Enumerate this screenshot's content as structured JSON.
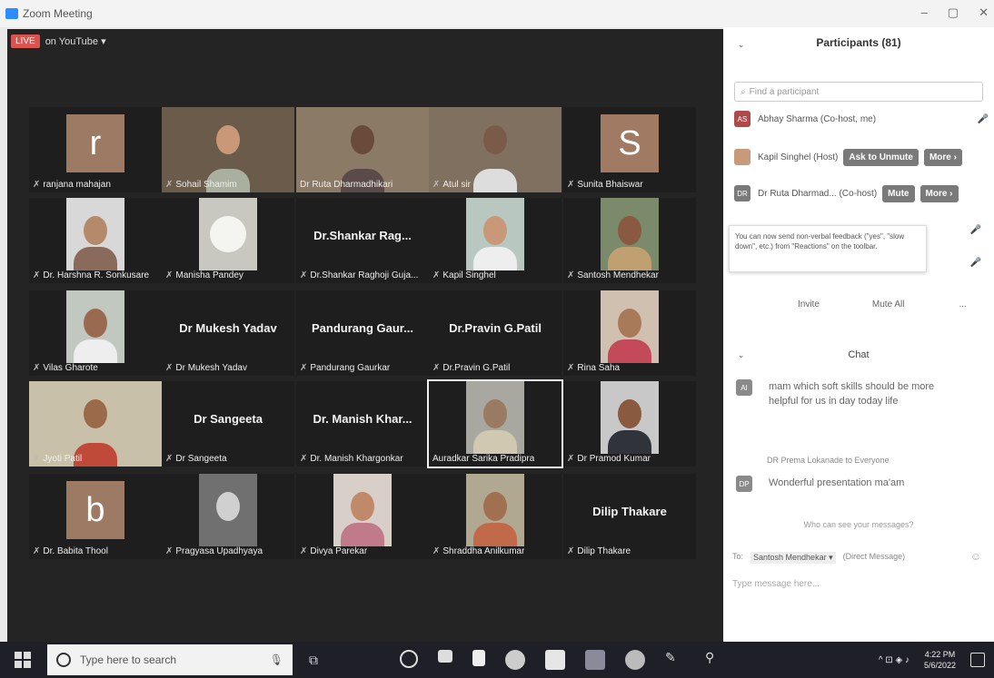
{
  "window": {
    "title": "Zoom Meeting"
  },
  "live": {
    "badge": "LIVE",
    "text": "on YouTube ▾"
  },
  "tiles": [
    {
      "name": "ranjana mahajan",
      "avatar_letter": "r"
    },
    {
      "name": "Sohail Shamim"
    },
    {
      "name": "Dr Ruta Dharmadhikari"
    },
    {
      "name": "Atul sir"
    },
    {
      "name": "Sunita Bhaiswar",
      "avatar_letter": "S"
    },
    {
      "name": "Dr. Harshna R. Sonkusare"
    },
    {
      "name": "Manisha Pandey"
    },
    {
      "name": "Dr.Shankar Raghoji Guja...",
      "display_name": "Dr.Shankar  Rag..."
    },
    {
      "name": "Kapil Singhel"
    },
    {
      "name": "Santosh Mendhekar"
    },
    {
      "name": "Vilas Gharote"
    },
    {
      "name": "Dr Mukesh Yadav",
      "display_name": "Dr Mukesh Yadav"
    },
    {
      "name": "Pandurang Gaurkar",
      "display_name": "Pandurang  Gaur..."
    },
    {
      "name": "Dr.Pravin G.Patil",
      "display_name": "Dr.Pravin G.Patil"
    },
    {
      "name": "Rina Saha"
    },
    {
      "name": "Jyoti Patil"
    },
    {
      "name": "Dr Sangeeta",
      "display_name": "Dr Sangeeta"
    },
    {
      "name": "Dr. Manish Khargonkar",
      "display_name": "Dr. Manish  Khar..."
    },
    {
      "name": "Auradkar Sarika Pradipra"
    },
    {
      "name": "Dr Pramod Kumar"
    },
    {
      "name": "Dr. Babita Thool",
      "avatar_letter": "b"
    },
    {
      "name": "Pragyasa Upadhyaya"
    },
    {
      "name": "Divya Parekar"
    },
    {
      "name": "Shraddha Anilkumar"
    },
    {
      "name": "Dilip Thakare",
      "display_name": "Dilip Thakare"
    }
  ],
  "participants": {
    "header": "Participants (81)",
    "search_placeholder": "Find a participant",
    "rows": [
      {
        "initials": "AS",
        "name": "Abhay Sharma (Co-host, me)"
      },
      {
        "name": "Kapil Singhel (Host)",
        "btn1": "Ask to Unmute",
        "btn2": "More ›"
      },
      {
        "initials": "DR",
        "name": "Dr Ruta Dharmad...  (Co-host)",
        "btn1": "Mute",
        "btn2": "More ›"
      }
    ],
    "tip": "You can now send non-verbal feedback (\"yes\", \"slow down\", etc.) from \"Reactions\" on the toolbar.",
    "footer": {
      "invite": "Invite",
      "mute_all": "Mute All",
      "more": "..."
    }
  },
  "chat": {
    "header": "Chat",
    "messages": [
      {
        "initials": "AI",
        "text": "mam which soft skills should be more helpful for us in day today life"
      },
      {
        "from": "DR Prema Lokanade to Everyone",
        "initials": "DP",
        "text": "Wonderful presentation ma'am"
      }
    ],
    "who_can_see": "Who can see your messages?",
    "to_label": "To:",
    "to_target": "Santosh Mendhekar ▾",
    "to_note": "(Direct Message)",
    "input_placeholder": "Type message here..."
  },
  "taskbar": {
    "search_placeholder": "Type here to search",
    "time": "4:22 PM",
    "date": "5/6/2022"
  },
  "colors": {
    "gallery_bg": "#242425",
    "accent": "#2d8cff",
    "live": "#d9534f"
  }
}
